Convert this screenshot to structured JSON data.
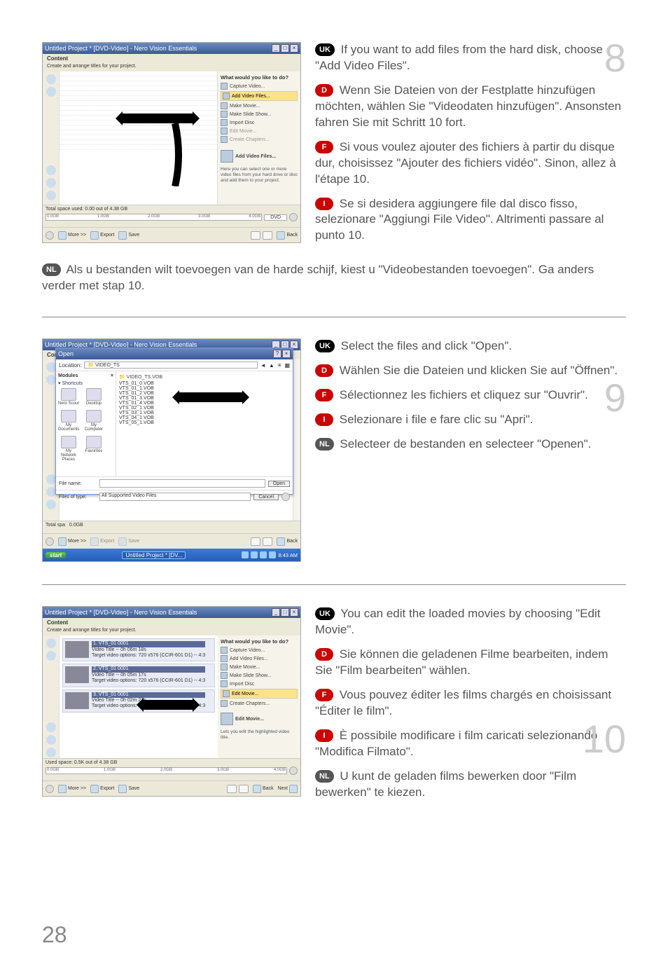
{
  "page_number": "28",
  "steps_numbers": {
    "s8": "8",
    "s9": "9",
    "s10": "10"
  },
  "lang_labels": {
    "uk": "UK",
    "d": "D",
    "f": "F",
    "i": "I",
    "nl": "NL"
  },
  "step8": {
    "uk": "If you want to add files from the hard disk, choose \"Add Video Files\".",
    "d": "Wenn Sie Dateien von der Festplatte hinzufügen möchten, wählen Sie \"Videodaten hinzufügen\". Ansonsten fahren Sie mit Schritt 10 fort.",
    "f": "Si vous voulez ajouter des fichiers à partir du disque dur, choisissez \"Ajouter des fichiers vidéo\". Sinon, allez à l'étape 10.",
    "i": "Se si desidera aggiungere file dal disco fisso, selezionare \"Aggiungi File Video\". Altrimenti passare al punto 10.",
    "nl": "Als u bestanden wilt toevoegen van de harde schijf, kiest u \"Videobestanden toevoegen\". Ga anders verder met stap 10."
  },
  "step9": {
    "uk": "Select the files and click \"Open\".",
    "d": "Wählen Sie die Dateien und klicken Sie auf \"Öffnen\".",
    "f": "Sélectionnez les fichiers et cliquez sur \"Ouvrir\".",
    "i": "Selezionare i file e fare clic su \"Apri\".",
    "nl": "Selecteer de bestanden en selecteer \"Openen\"."
  },
  "step10": {
    "uk": "You can edit the loaded movies by choosing \"Edit Movie\".",
    "d": "Sie können die geladenen Filme bearbeiten, indem Sie \"Film bearbeiten\" wählen.",
    "f": "Vous pouvez éditer les films chargés en choisissant \"Éditer le film\".",
    "i": "È possibile modificare i film caricati selezionando \"Modifica Filmato\".",
    "nl": "U kunt de geladen films bewerken door \"Film bewerken\" te kiezen."
  },
  "win_common": {
    "title": "Untitled Project * [DVD-Video] - Nero Vision Essentials",
    "content_tab": "Content",
    "subtext": "Create and arrange titles for your project.",
    "footer_more": "More >>",
    "footer_export": "Export",
    "footer_save": "Save",
    "footer_back": "Back",
    "footer_next": "Next",
    "rp_title": "What would you like to do?",
    "rp_capture": "Capture Video...",
    "rp_add": "Add Video Files...",
    "rp_movie": "Make Movie...",
    "rp_slide": "Make Slide Show...",
    "rp_import": "Import Disc",
    "rp_edit": "Edit Movie...",
    "rp_chapters": "Create Chapters...",
    "dvd": "DVD"
  },
  "win8": {
    "used": "Total space used: 0.00 out of 4.38 GB",
    "scale": [
      "0.0GB",
      "1.0GB",
      "2.0GB",
      "3.0GB",
      "4.0GB"
    ],
    "rp_note": "Here you can select one or more video files from your hard drive or disc and add them to your project.",
    "rp_add_big": "Add Video Files..."
  },
  "win9": {
    "open": "Open",
    "location_label": "Location:",
    "location": "VIDEO_TS",
    "modules": "Modules",
    "shortcuts": "Shortcuts",
    "places": [
      "Nero Scout",
      "Desktop",
      "My Documents",
      "My Computer",
      "My Network Places",
      "Favorites"
    ],
    "filehead": "VIDEO_TS.VOB",
    "files": [
      "VTS_01_0.VOB",
      "VTS_01_1.VOB",
      "VTS_01_2.VOB",
      "VTS_01_3.VOB",
      "VTS_01_4.VOB",
      "VTS_02_1.VOB",
      "VTS_03_1.VOB",
      "VTS_04_1.VOB",
      "VTS_05_1.VOB"
    ],
    "filename_lbl": "File name:",
    "filetype_lbl": "Files of type:",
    "filetype_val": "All Supported Video Files",
    "btn_open": "Open",
    "btn_cancel": "Cancel",
    "used": "Total spa",
    "scale0": "0.0GB",
    "start": "start",
    "tasktitle": "Untitled Project * [DV...",
    "clock": "8:43 AM"
  },
  "win10": {
    "items": [
      {
        "n": "1. VTS_01 0001",
        "vt": "Video Title -- 0h 06m 18s",
        "opt": "Target video options: 720 x576 (CCIR-601 D1) -- 4:3"
      },
      {
        "n": "2. VTS_01 0001",
        "vt": "Video Title -- 0h 05m 17s",
        "opt": "Target video options: 720 x576 (CCIR-601 D1) -- 4:3"
      },
      {
        "n": "3. VTS_01 0001",
        "vt": "Video Title -- 0h 02m 27s",
        "opt": "Target video options: 720 x576 (CCIR-601 D1) -- 4:3"
      }
    ],
    "rp_note": "Lets you edit the highlighted video title.",
    "rp_edit_big": "Edit Movie...",
    "used": "Used space: 0.5K out of 4.38 GB",
    "scale": [
      "0.0GB",
      "1.0GB",
      "2.0GB",
      "3.0GB",
      "4.0GB"
    ]
  }
}
